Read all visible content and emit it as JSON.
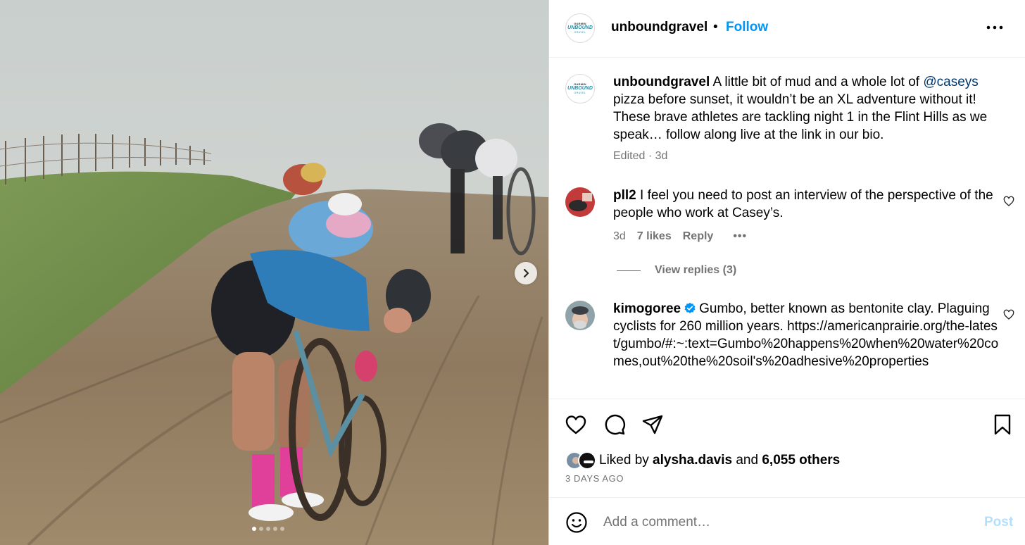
{
  "post": {
    "username": "unboundgravel",
    "separator": "•",
    "follow_label": "Follow",
    "brand_avatar": {
      "line1": "GARMIN",
      "line2": "UNBOUND",
      "line3": "GRAVEL"
    },
    "image_carousel": {
      "total_slides": 5,
      "active_slide": 1
    }
  },
  "caption": {
    "username": "unboundgravel",
    "text_before": "A little bit of mud and a whole lot of ",
    "mention": "@caseys",
    "text_after": " pizza before sunset, it wouldn’t be an XL adventure without it! These brave athletes are tackling night 1 in the Flint Hills as we speak… follow along live at the link in our bio.",
    "meta": "Edited · 3d"
  },
  "comments": [
    {
      "username": "pll2",
      "text": "I feel you need to post an interview of the perspective of the people who work at Casey’s.",
      "time": "3d",
      "likes": "7 likes",
      "reply_label": "Reply",
      "more_label": "•••",
      "view_replies": "View replies (3)"
    },
    {
      "username": "kimogoree",
      "verified": true,
      "text": "Gumbo, better known as bentonite clay. Plaguing cyclists for 260 million years. https://americanprairie.org/the-latest/gumbo/#:~:text=Gumbo%20happens%20when%20water%20comes,out%20the%20soil's%20adhesive%20properties"
    }
  ],
  "likes": {
    "prefix": "Liked by ",
    "user": "alysha.davis",
    "middle": " and ",
    "others": "6,055 others"
  },
  "time_ago": "3 DAYS AGO",
  "add_comment": {
    "placeholder": "Add a comment…",
    "post_label": "Post"
  },
  "colors": {
    "accent": "#0095f6",
    "mention": "#00376b",
    "muted": "#737373",
    "post_disabled": "#b2dffc",
    "verified": "#0095f6"
  }
}
